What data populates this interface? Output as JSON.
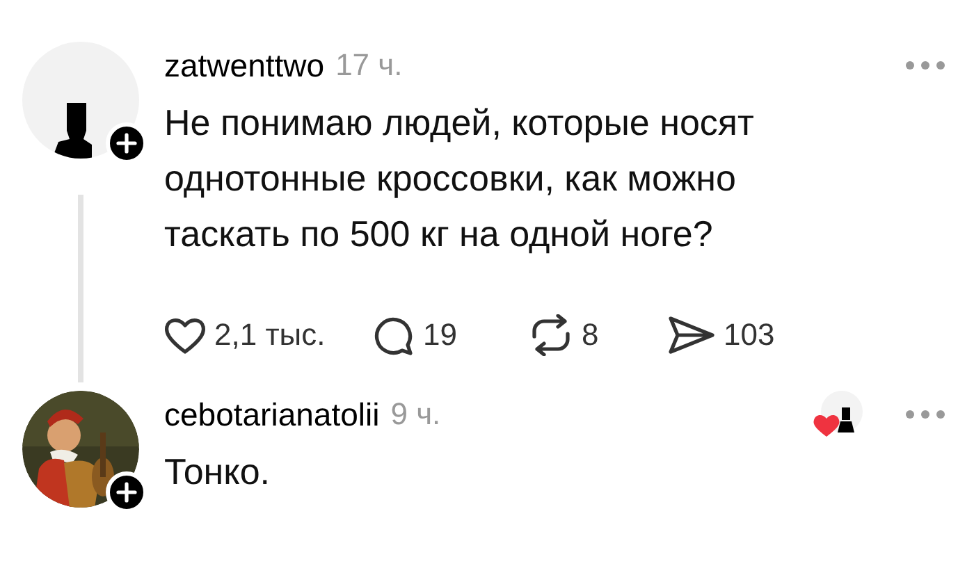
{
  "posts": [
    {
      "username": "zatwenttwo",
      "time": "17 ч.",
      "avatar": {
        "kind": "silhouette"
      },
      "text": "Не понимаю людей, которые носят однотонные кроссовки, как можно таскать по 500 кг на одной ноге?",
      "thread_line": true,
      "liked_by_author": false,
      "actions": [
        {
          "kind": "like",
          "count": "2,1 тыс."
        },
        {
          "kind": "reply",
          "count": "19"
        },
        {
          "kind": "repost",
          "count": "8"
        },
        {
          "kind": "share",
          "count": "103"
        }
      ]
    },
    {
      "username": "cebotarianatolii",
      "time": "9 ч.",
      "text": "Тонко.",
      "thread_line": false,
      "liked_by_author": true
    }
  ]
}
